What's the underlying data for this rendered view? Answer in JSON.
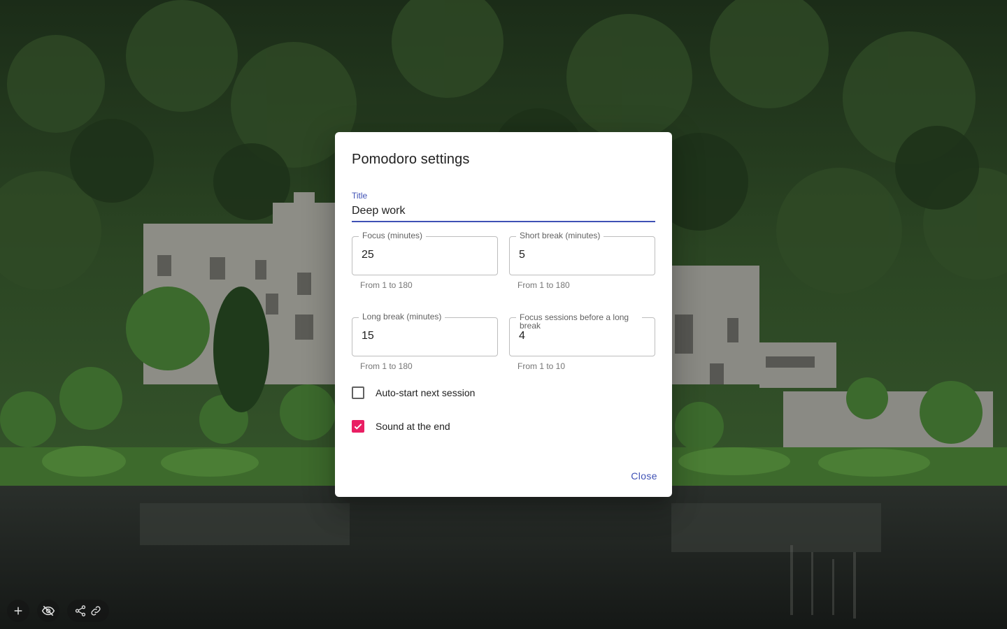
{
  "dialog": {
    "title": "Pomodoro settings",
    "title_field": {
      "label": "Title",
      "value": "Deep work"
    },
    "focus": {
      "label": "Focus (minutes)",
      "value": "25",
      "helper": "From 1 to 180"
    },
    "short_break": {
      "label": "Short break (minutes)",
      "value": "5",
      "helper": "From 1 to 180"
    },
    "long_break": {
      "label": "Long break (minutes)",
      "value": "15",
      "helper": "From 1 to 180"
    },
    "sessions": {
      "label": "Focus sessions before a long break",
      "value": "4",
      "helper": "From 1 to 10"
    },
    "auto_start": {
      "label": "Auto-start next session",
      "checked": false
    },
    "sound": {
      "label": "Sound at the end",
      "checked": true
    },
    "close_label": "Close"
  },
  "toolbar": {
    "add_icon": "plus-icon",
    "hide_icon": "eye-off-icon",
    "share_icons": [
      "share-icon",
      "link-icon"
    ]
  },
  "colors": {
    "primary": "#3f51b5",
    "accent": "#e91e63"
  }
}
